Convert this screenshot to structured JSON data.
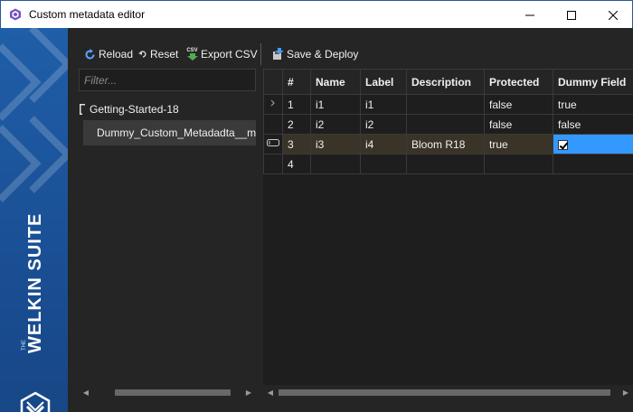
{
  "window": {
    "title": "Custom metadata editor"
  },
  "brand": {
    "name": "WELKIN SUITE",
    "prefix": "THE",
    "color": "#1f5ea8"
  },
  "toolbar": {
    "reload": "Reload",
    "reset": "Reset",
    "export_csv": "Export CSV",
    "csv_badge": "CSV",
    "save_deploy": "Save & Deploy"
  },
  "tree": {
    "filter_placeholder": "Filter...",
    "root": "Getting-Started-18",
    "child": "Dummy_Custom_Metadadta__m"
  },
  "grid": {
    "columns": [
      "#",
      "Name",
      "Label",
      "Description",
      "Protected",
      "Dummy Field"
    ],
    "rows": [
      {
        "num": "1",
        "name": "i1",
        "label": "i1",
        "description": "",
        "protected": "false",
        "dummy": "true"
      },
      {
        "num": "2",
        "name": "i2",
        "label": "i2",
        "description": "",
        "protected": "false",
        "dummy": "false"
      },
      {
        "num": "3",
        "name": "i3",
        "label": "i4",
        "description": "Bloom R18",
        "protected": "true",
        "dummy_checked": true
      },
      {
        "num": "4",
        "name": "",
        "label": "",
        "description": "",
        "protected": "",
        "dummy": ""
      }
    ]
  },
  "colors": {
    "selection": "#3399ff",
    "editing_row": "#3a3328",
    "accent": "#d79a1a"
  }
}
